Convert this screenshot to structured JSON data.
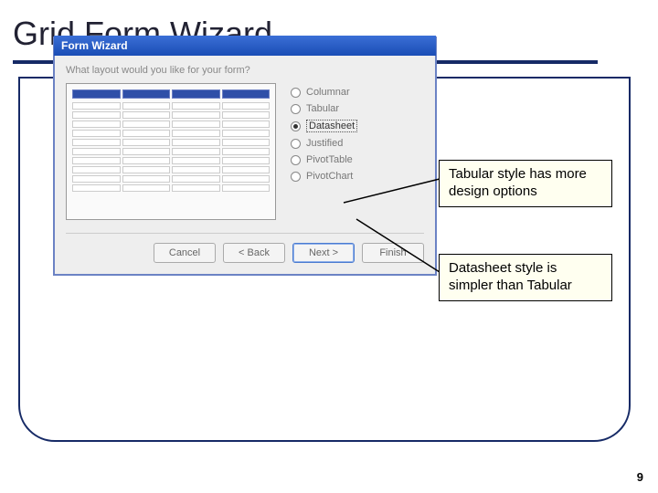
{
  "slide": {
    "title": "Grid Form Wizard",
    "page_number": "9"
  },
  "wizard": {
    "titlebar": "Form Wizard",
    "prompt": "What layout would you like for your form?",
    "options": {
      "columnar": "Columnar",
      "tabular": "Tabular",
      "datasheet": "Datasheet",
      "justified": "Justified",
      "pivottable": "PivotTable",
      "pivotchart": "PivotChart"
    },
    "selected": "datasheet",
    "buttons": {
      "cancel": "Cancel",
      "back": "< Back",
      "next": "Next >",
      "finish": "Finish"
    }
  },
  "callouts": {
    "tabular": "Tabular style has more design options",
    "datasheet": "Datasheet style is simpler than Tabular"
  }
}
